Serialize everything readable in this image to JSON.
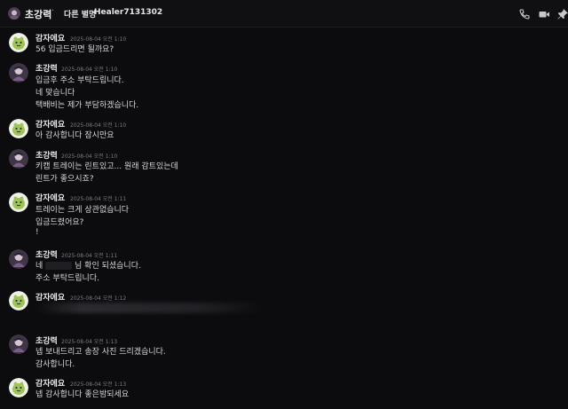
{
  "header": {
    "title": "초강력",
    "separator": "·",
    "tag": "다른 별명",
    "username": "Healer7131302"
  },
  "users": {
    "u1": "초강력",
    "u2": "감자에요"
  },
  "messages": [
    {
      "author": "감자에요",
      "time": "2025-08-04 오전 1:10",
      "lines": [
        "56 입금드리면 될까요?"
      ]
    },
    {
      "author": "초강력",
      "time": "2025-08-04 오전 1:10",
      "lines": [
        "입금후 주소 부탁드립니다.",
        "네 맞습니다",
        "택배비는 제가 부담하겠습니다."
      ]
    },
    {
      "author": "감자에요",
      "time": "2025-08-04 오전 1:10",
      "lines": [
        "아 감사합니다 잠시만요"
      ]
    },
    {
      "author": "초강력",
      "time": "2025-08-04 오전 1:10",
      "lines": [
        "키캡 트레이는 린트있고... 원래 감트있는데",
        "린트가 좋으시죠?"
      ]
    },
    {
      "author": "감자에요",
      "time": "2025-08-04 오전 1:11",
      "lines": [
        "트레이는 크게 상관없습니다",
        "입금드렸어요?",
        "!"
      ]
    },
    {
      "author": "초강력",
      "time": "2025-08-04 오전 1:11",
      "lines_a": "네",
      "lines_b": "님 확인 되셨습니다.",
      "lines": [
        "주소 부탁드립니다."
      ]
    },
    {
      "author": "감자에요",
      "time": "2025-08-04 오전 1:12",
      "lines": []
    },
    {
      "author": "초강력",
      "time": "2025-08-04 오전 1:13",
      "lines": [
        "넵 보내드리고 송장 사진 드리겠습니다.",
        "감사합니다."
      ]
    },
    {
      "author": "감자에요",
      "time": "2025-08-04 오전 1:13",
      "lines": [
        "넵 감사합니다 좋은밤되세요"
      ]
    }
  ]
}
